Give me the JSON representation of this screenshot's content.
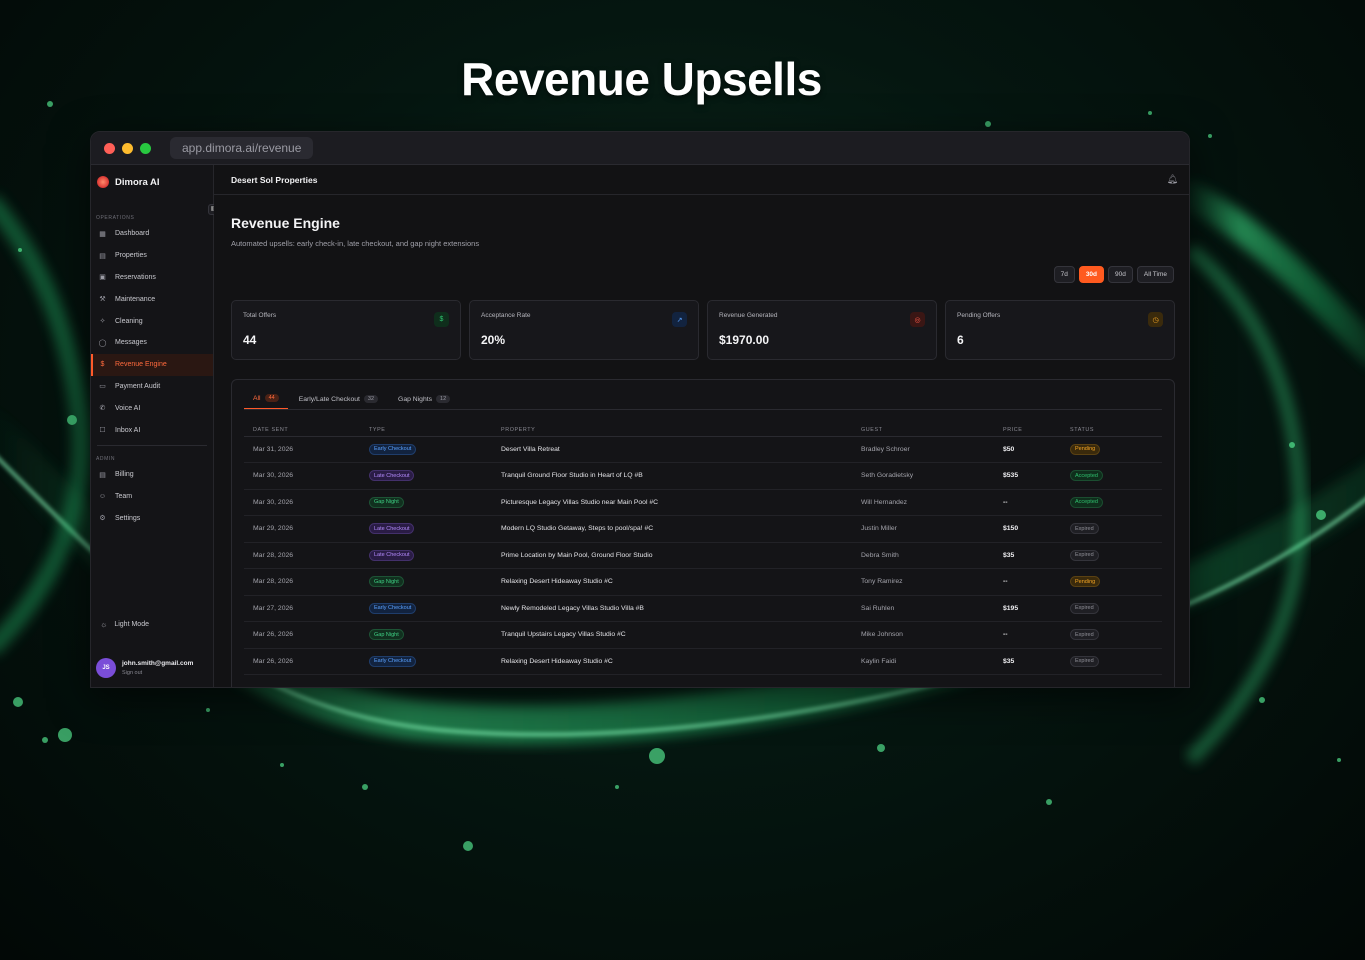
{
  "hero": {
    "title": "Revenue Upsells"
  },
  "browser": {
    "url": "app.dimora.ai/revenue"
  },
  "brand": {
    "name": "Dimora AI"
  },
  "sidebar": {
    "operations_label": "OPERATIONS",
    "operations": [
      {
        "label": "Dashboard",
        "icon": "dashboard-icon",
        "glyph": "▦"
      },
      {
        "label": "Properties",
        "icon": "building-icon",
        "glyph": "▤"
      },
      {
        "label": "Reservations",
        "icon": "calendar-icon",
        "glyph": "▣"
      },
      {
        "label": "Maintenance",
        "icon": "wrench-icon",
        "glyph": "⚒"
      },
      {
        "label": "Cleaning",
        "icon": "sparkle-icon",
        "glyph": "✧"
      },
      {
        "label": "Messages",
        "icon": "chat-icon",
        "glyph": "◯"
      },
      {
        "label": "Revenue Engine",
        "icon": "dollar-icon",
        "glyph": "$"
      },
      {
        "label": "Payment Audit",
        "icon": "card-icon",
        "glyph": "▭"
      },
      {
        "label": "Voice AI",
        "icon": "phone-icon",
        "glyph": "✆"
      },
      {
        "label": "Inbox AI",
        "icon": "inbox-icon",
        "glyph": "☐"
      }
    ],
    "admin_label": "ADMIN",
    "admin": [
      {
        "label": "Billing",
        "icon": "receipt-icon",
        "glyph": "▤"
      },
      {
        "label": "Team",
        "icon": "users-icon",
        "glyph": "☺"
      },
      {
        "label": "Settings",
        "icon": "gear-icon",
        "glyph": "⚙"
      }
    ],
    "light_mode": "Light Mode",
    "user": {
      "initials": "JS",
      "email": "john.smith@gmail.com",
      "sign_out": "Sign out"
    }
  },
  "topbar": {
    "org": "Desert Sol Properties"
  },
  "page": {
    "title": "Revenue Engine",
    "subtitle": "Automated upsells: early check-in, late checkout, and gap night extensions"
  },
  "ranges": [
    {
      "label": "7d",
      "active": false
    },
    {
      "label": "30d",
      "active": true
    },
    {
      "label": "90d",
      "active": false
    },
    {
      "label": "All Time",
      "active": false
    }
  ],
  "stats": [
    {
      "label": "Total Offers",
      "value": "44",
      "icon": "dollar-icon",
      "glyph": "$",
      "color": "#2fc16e",
      "bg": "#0f2e1c"
    },
    {
      "label": "Acceptance Rate",
      "value": "20%",
      "icon": "trend-up-icon",
      "glyph": "↗",
      "color": "#5aa2ff",
      "bg": "#12233f"
    },
    {
      "label": "Revenue Generated",
      "value": "$1970.00",
      "icon": "target-icon",
      "glyph": "◎",
      "color": "#ff5a4a",
      "bg": "#3a1614"
    },
    {
      "label": "Pending Offers",
      "value": "6",
      "icon": "clock-icon",
      "glyph": "◷",
      "color": "#f5a524",
      "bg": "#3a2a0c"
    }
  ],
  "tabs": [
    {
      "label": "All",
      "count": "44",
      "active": true
    },
    {
      "label": "Early/Late Checkout",
      "count": "32",
      "active": false
    },
    {
      "label": "Gap Nights",
      "count": "12",
      "active": false
    }
  ],
  "table": {
    "headers": [
      "DATE SENT",
      "TYPE",
      "PROPERTY",
      "GUEST",
      "PRICE",
      "STATUS"
    ],
    "rows": [
      {
        "date": "Mar 31, 2026",
        "type": "Early Checkout",
        "type_kind": "early",
        "property": "Desert Villa Retreat",
        "guest": "Bradley Schroer",
        "price": "$50",
        "status": "Pending",
        "status_kind": "pending"
      },
      {
        "date": "Mar 30, 2026",
        "type": "Late Checkout",
        "type_kind": "late",
        "property": "Tranquil Ground Floor Studio in Heart of LQ #B",
        "guest": "Seth Goradietsky",
        "price": "$535",
        "status": "Accepted",
        "status_kind": "accepted"
      },
      {
        "date": "Mar 30, 2026",
        "type": "Gap Night",
        "type_kind": "gap",
        "property": "Picturesque Legacy Villas Studio near Main Pool #C",
        "guest": "Will Hernandez",
        "price": "--",
        "status": "Accepted",
        "status_kind": "accepted"
      },
      {
        "date": "Mar 29, 2026",
        "type": "Late Checkout",
        "type_kind": "late",
        "property": "Modern LQ Studio Getaway, Steps to pool/spa! #C",
        "guest": "Justin Miller",
        "price": "$150",
        "status": "Expired",
        "status_kind": "expired"
      },
      {
        "date": "Mar 28, 2026",
        "type": "Late Checkout",
        "type_kind": "late",
        "property": "Prime Location by Main Pool, Ground Floor Studio",
        "guest": "Debra Smith",
        "price": "$35",
        "status": "Expired",
        "status_kind": "expired"
      },
      {
        "date": "Mar 28, 2026",
        "type": "Gap Night",
        "type_kind": "gap",
        "property": "Relaxing Desert Hideaway Studio #C",
        "guest": "Tony Ramirez",
        "price": "--",
        "status": "Pending",
        "status_kind": "pending"
      },
      {
        "date": "Mar 27, 2026",
        "type": "Early Checkout",
        "type_kind": "early",
        "property": "Newly Remodeled Legacy Villas Studio Villa #B",
        "guest": "Sai Ruhlen",
        "price": "$195",
        "status": "Expired",
        "status_kind": "expired"
      },
      {
        "date": "Mar 26, 2026",
        "type": "Gap Night",
        "type_kind": "gap",
        "property": "Tranquil Upstairs Legacy Villas Studio #C",
        "guest": "Mike Johnson",
        "price": "--",
        "status": "Expired",
        "status_kind": "expired"
      },
      {
        "date": "Mar 26, 2026",
        "type": "Early Checkout",
        "type_kind": "early",
        "property": "Relaxing Desert Hideaway Studio #C",
        "guest": "Kaylin Faidi",
        "price": "$35",
        "status": "Expired",
        "status_kind": "expired"
      }
    ]
  }
}
